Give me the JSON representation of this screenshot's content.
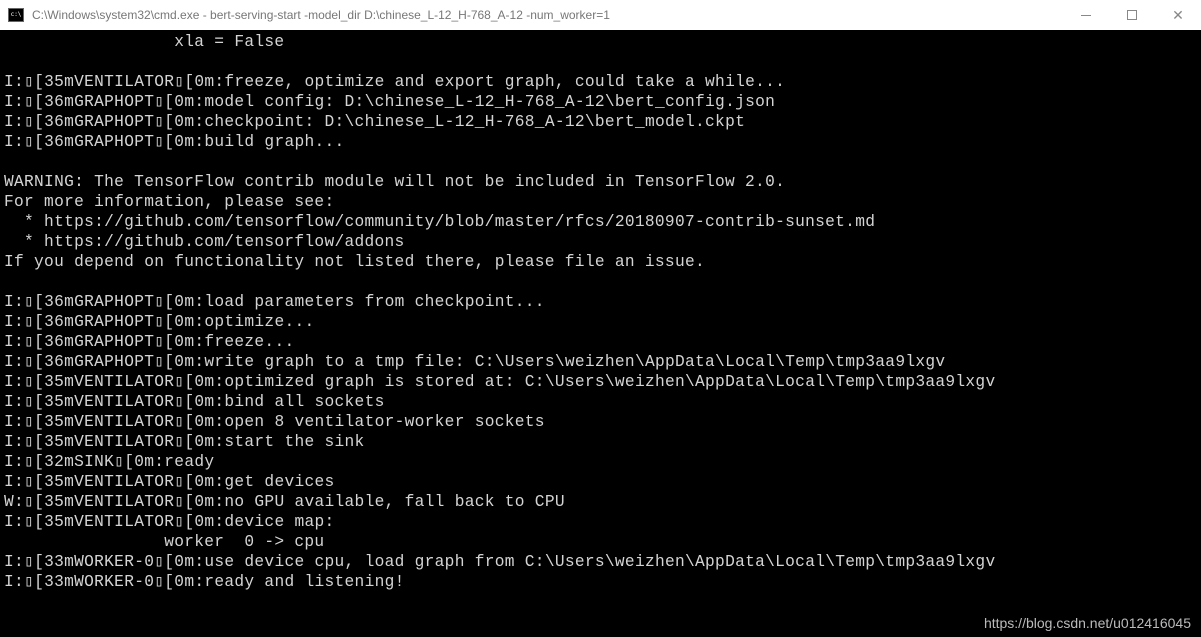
{
  "window": {
    "title": "C:\\Windows\\system32\\cmd.exe - bert-serving-start  -model_dir D:\\chinese_L-12_H-768_A-12 -num_worker=1"
  },
  "terminal": {
    "lines": [
      "                 xla = False",
      "",
      "I:▯[35mVENTILATOR▯[0m:freeze, optimize and export graph, could take a while...",
      "I:▯[36mGRAPHOPT▯[0m:model config: D:\\chinese_L-12_H-768_A-12\\bert_config.json",
      "I:▯[36mGRAPHOPT▯[0m:checkpoint: D:\\chinese_L-12_H-768_A-12\\bert_model.ckpt",
      "I:▯[36mGRAPHOPT▯[0m:build graph...",
      "",
      "WARNING: The TensorFlow contrib module will not be included in TensorFlow 2.0.",
      "For more information, please see:",
      "  * https://github.com/tensorflow/community/blob/master/rfcs/20180907-contrib-sunset.md",
      "  * https://github.com/tensorflow/addons",
      "If you depend on functionality not listed there, please file an issue.",
      "",
      "I:▯[36mGRAPHOPT▯[0m:load parameters from checkpoint...",
      "I:▯[36mGRAPHOPT▯[0m:optimize...",
      "I:▯[36mGRAPHOPT▯[0m:freeze...",
      "I:▯[36mGRAPHOPT▯[0m:write graph to a tmp file: C:\\Users\\weizhen\\AppData\\Local\\Temp\\tmp3aa9lxgv",
      "I:▯[35mVENTILATOR▯[0m:optimized graph is stored at: C:\\Users\\weizhen\\AppData\\Local\\Temp\\tmp3aa9lxgv",
      "I:▯[35mVENTILATOR▯[0m:bind all sockets",
      "I:▯[35mVENTILATOR▯[0m:open 8 ventilator-worker sockets",
      "I:▯[35mVENTILATOR▯[0m:start the sink",
      "I:▯[32mSINK▯[0m:ready",
      "I:▯[35mVENTILATOR▯[0m:get devices",
      "W:▯[35mVENTILATOR▯[0m:no GPU available, fall back to CPU",
      "I:▯[35mVENTILATOR▯[0m:device map: ",
      "                worker  0 -> cpu",
      "I:▯[33mWORKER-0▯[0m:use device cpu, load graph from C:\\Users\\weizhen\\AppData\\Local\\Temp\\tmp3aa9lxgv",
      "I:▯[33mWORKER-0▯[0m:ready and listening!"
    ]
  },
  "watermark": "https://blog.csdn.net/u012416045"
}
